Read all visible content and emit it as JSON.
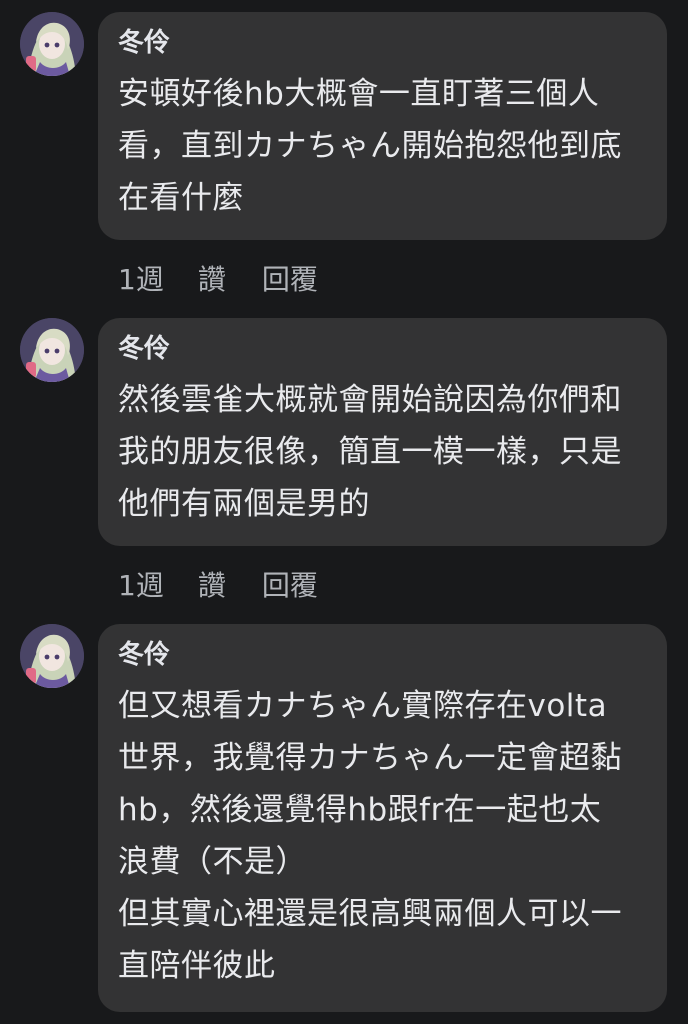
{
  "comments": [
    {
      "author": "冬伶",
      "text": "安頓好後hb大概會一直盯著三個人\n看，直到カナちゃん開始抱怨他到底\n在看什麼",
      "time": "1週",
      "like_label": "讚",
      "reply_label": "回覆"
    },
    {
      "author": "冬伶",
      "text": "然後雲雀大概就會開始說因為你們和\n我的朋友很像，簡直一模一樣，只是\n他們有兩個是男的",
      "time": "1週",
      "like_label": "讚",
      "reply_label": "回覆"
    },
    {
      "author": "冬伶",
      "text": "但又想看カナちゃん實際存在volta\n世界，我覺得カナちゃん一定會超黏\nhb，然後還覺得hb跟fr在一起也太\n浪費（不是）\n但其實心裡還是很高興兩個人可以一\n直陪伴彼此"
    }
  ],
  "colors": {
    "background": "#18191b",
    "bubble": "#333334",
    "text": "#e9eaed",
    "meta": "#b0b3b8"
  },
  "icons": {
    "avatar": "anime-character-avatar"
  }
}
